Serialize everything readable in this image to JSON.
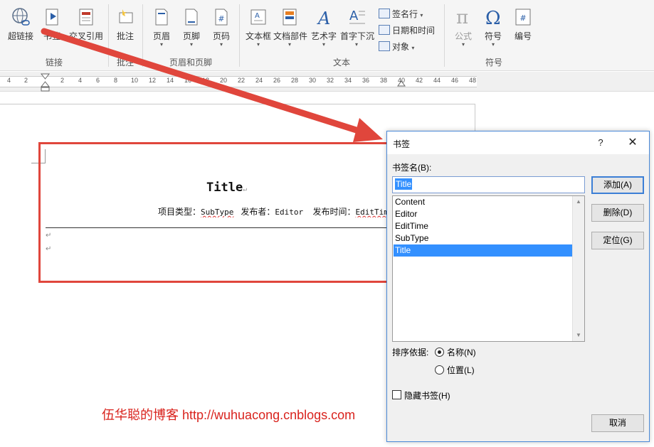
{
  "ribbon": {
    "groups": {
      "links": "链接",
      "comments": "批注",
      "header_footer": "页眉和页脚",
      "text": "文本",
      "symbols": "符号"
    },
    "buttons": {
      "hyperlink": "超链接",
      "bookmark": "书签",
      "cross_ref": "交叉引用",
      "comment": "批注",
      "header": "页眉",
      "footer": "页脚",
      "page_number": "页码",
      "text_box": "文本框",
      "quick_parts": "文档部件",
      "wordart": "艺术字",
      "dropcap": "首字下沉",
      "signature_line": "签名行",
      "date_time": "日期和时间",
      "object": "对象",
      "equation": "公式",
      "symbol": "符号",
      "numbering": "编号"
    },
    "icon_glyphs": {
      "equation": "π",
      "symbol": "Ω",
      "wordart": "A",
      "page_number": "#",
      "numbering": "#"
    }
  },
  "ruler": {
    "ticks": [
      "4",
      "2",
      "2",
      "4",
      "6",
      "8",
      "10",
      "12",
      "14",
      "16",
      "18",
      "20",
      "22",
      "24",
      "26",
      "28",
      "30",
      "32",
      "34",
      "36",
      "38",
      "40",
      "42",
      "44",
      "46",
      "48"
    ]
  },
  "document": {
    "title": "Title",
    "meta_label_type": "项目类型：",
    "meta_value_type": "SubType",
    "meta_label_publisher": "发布者：",
    "meta_value_publisher": "Editor",
    "meta_label_time": "发布时间：",
    "meta_value_time": "EditTime",
    "para_mark": "↵"
  },
  "watermark": "伍华聪的博客  http://wuhuacong.cnblogs.com",
  "dialog": {
    "title": "书签",
    "help": "?",
    "close": "✕",
    "name_label": "书签名(B):",
    "name_value": "Title",
    "bookmarks": [
      "Content",
      "Editor",
      "EditTime",
      "SubType",
      "Title"
    ],
    "selected_bookmark": "Title",
    "add_button": "添加(A)",
    "delete_button": "删除(D)",
    "goto_button": "定位(G)",
    "sort_label": "排序依据:",
    "sort_by_name": "名称(N)",
    "sort_by_location": "位置(L)",
    "sort_selected": "name",
    "hidden_bookmarks": "隐藏书签(H)",
    "hidden_checked": false,
    "cancel_button": "取消"
  },
  "colors": {
    "annotation_red": "#e0463c",
    "selection_blue": "#3390ff",
    "watermark_red": "#d9231d"
  }
}
